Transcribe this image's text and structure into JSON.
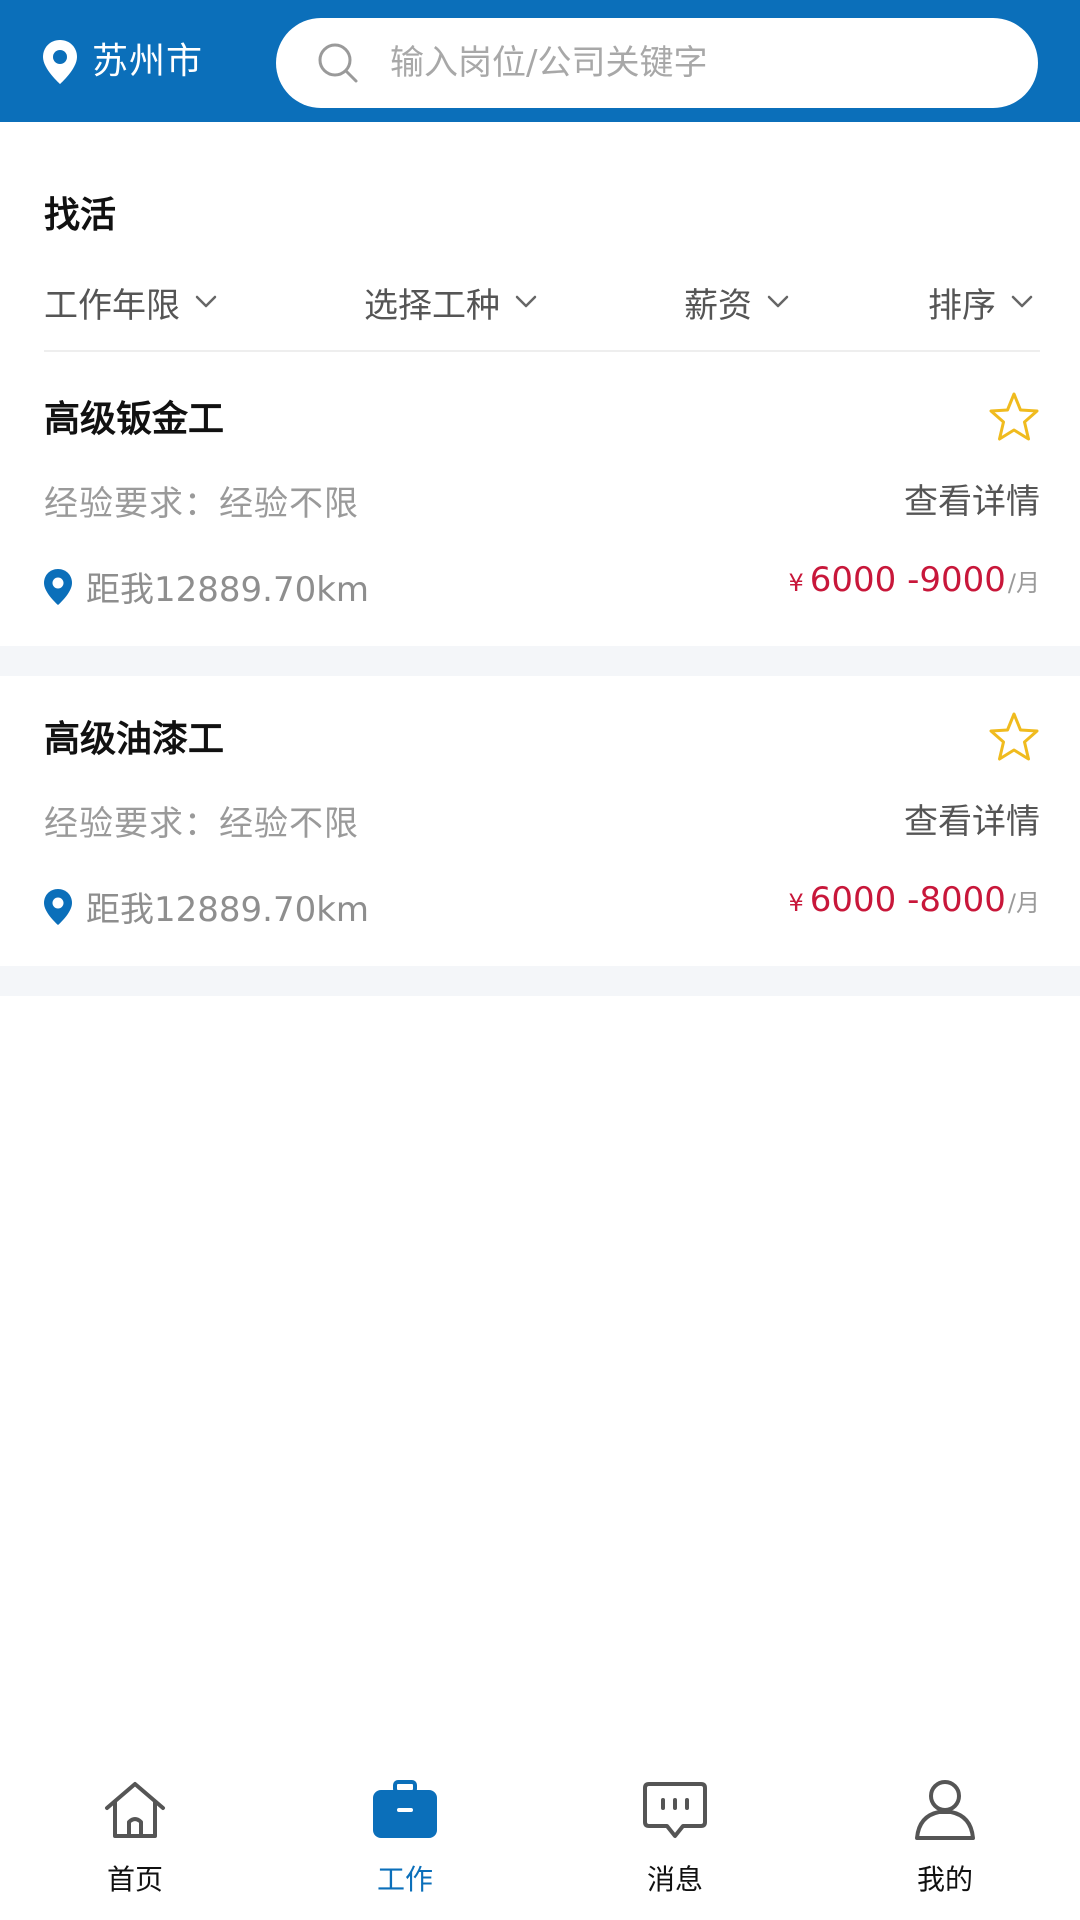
{
  "header": {
    "city": "苏州市",
    "search_placeholder": "输入岗位/公司关键字",
    "accent_color": "#0b6fba"
  },
  "section_title": "找活",
  "filters": [
    {
      "label": "工作年限",
      "icon": "chevron-down-icon"
    },
    {
      "label": "选择工种",
      "icon": "chevron-down-icon"
    },
    {
      "label": "薪资",
      "icon": "chevron-down-icon"
    },
    {
      "label": "排序",
      "icon": "chevron-down-icon"
    }
  ],
  "jobs": [
    {
      "title": "高级钣金工",
      "experience": "经验要求：经验不限",
      "detail_link": "查看详情",
      "distance": "距我12889.70km",
      "currency": "¥",
      "salary": "6000 -9000",
      "unit": "/月",
      "favorited": false
    },
    {
      "title": "高级油漆工",
      "experience": "经验要求：经验不限",
      "detail_link": "查看详情",
      "distance": "距我12889.70km",
      "currency": "¥",
      "salary": "6000 -8000",
      "unit": "/月",
      "favorited": false
    }
  ],
  "bottom_nav": [
    {
      "label": "首页",
      "icon": "home-icon",
      "active": false
    },
    {
      "label": "工作",
      "icon": "briefcase-icon",
      "active": true
    },
    {
      "label": "消息",
      "icon": "message-icon",
      "active": false
    },
    {
      "label": "我的",
      "icon": "user-icon",
      "active": false
    }
  ],
  "colors": {
    "salary": "#c8173a",
    "star": "#f0bb1e",
    "muted_text": "#9a9a9a"
  }
}
